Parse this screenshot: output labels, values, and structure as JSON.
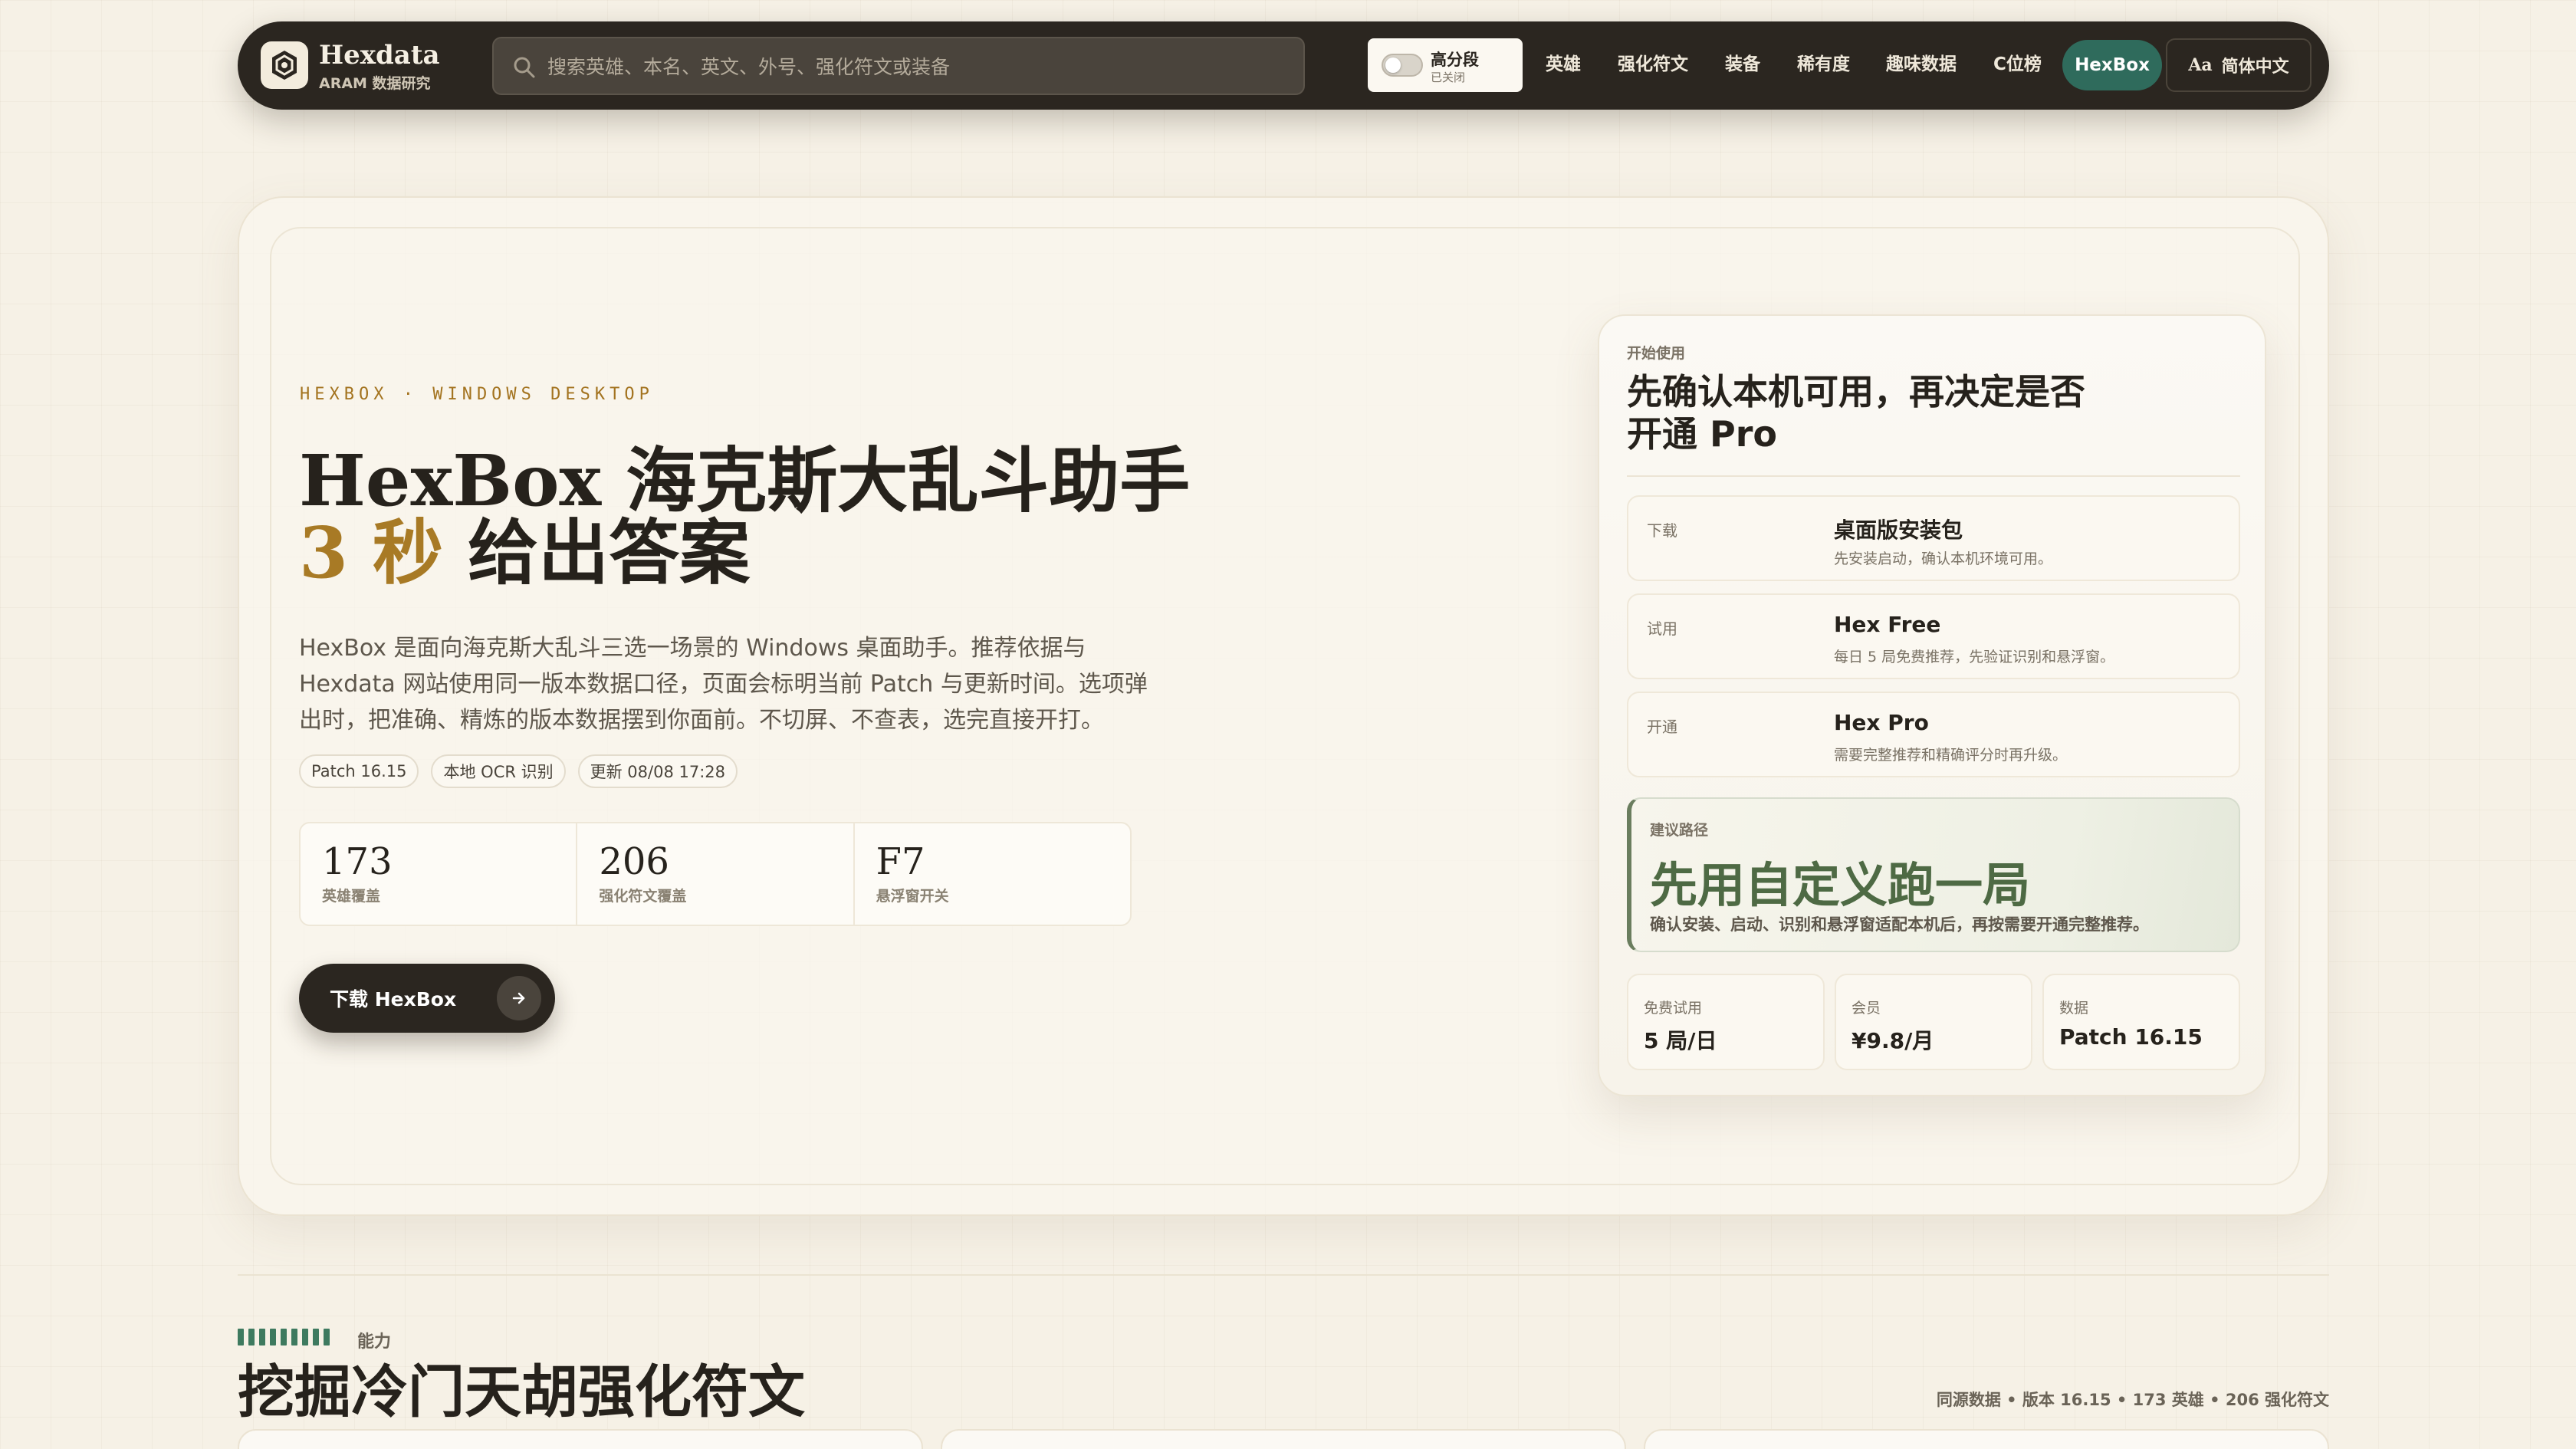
{
  "brand": {
    "name": "Hexdata",
    "subtitle": "ARAM 数据研究",
    "logo_icon": "hex-logo-icon"
  },
  "search": {
    "placeholder": "搜索英雄、本名、英文、外号、强化符文或装备"
  },
  "toggle": {
    "label": "高分段",
    "state": "已关闭",
    "on": false
  },
  "nav": {
    "links": [
      "英雄",
      "强化符文",
      "装备",
      "稀有度",
      "趣味数据",
      "C位榜"
    ],
    "active": "HexBox",
    "lang_icon": "Aa",
    "lang_label": "简体中文"
  },
  "hero": {
    "eyebrow": "HEXBOX · WINDOWS DESKTOP",
    "title_line1": "HexBox 海克斯大乱斗助手",
    "title_accent": "3 秒",
    "title_line2_rest": " 给出答案",
    "lead": "HexBox 是面向海克斯大乱斗三选一场景的 Windows 桌面助手。推荐依据与 Hexdata 网站使用同一版本数据口径，页面会标明当前 Patch 与更新时间。选项弹出时，把准确、精炼的版本数据摆到你面前。不切屏、不查表，选完直接开打。",
    "chips": [
      "Patch 16.15",
      "本地 OCR 识别",
      "更新 08/08 17:28"
    ],
    "stats": [
      {
        "value": "173",
        "label": "英雄覆盖"
      },
      {
        "value": "206",
        "label": "强化符文覆盖"
      },
      {
        "value": "F7",
        "label": "悬浮窗开关"
      }
    ],
    "cta_label": "下载 HexBox",
    "accent_color": "#a87a25"
  },
  "card": {
    "kicker": "开始使用",
    "title": "先确认本机可用，再决定是否开通 Pro",
    "steps": [
      {
        "key": "下载",
        "title": "桌面版安装包",
        "desc": "先安装启动，确认本机环境可用。"
      },
      {
        "key": "试用",
        "title": "Hex Free",
        "desc": "每日 5 局免费推荐，先验证识别和悬浮窗。"
      },
      {
        "key": "开通",
        "title": "Hex Pro",
        "desc": "需要完整推荐和精确评分时再升级。"
      }
    ],
    "path": {
      "kicker": "建议路径",
      "title": "先用自定义跑一局",
      "desc": "确认安装、启动、识别和悬浮窗适配本机后，再按需要开通完整推荐。"
    },
    "mini": [
      {
        "key": "免费试用",
        "value": "5 局/日"
      },
      {
        "key": "会员",
        "value": "¥9.8/月"
      },
      {
        "key": "数据",
        "value": "Patch 16.15"
      }
    ]
  },
  "section": {
    "kicker": "能力",
    "title": "挖掘冷门天胡强化符文",
    "meta": "同源数据 • 版本 16.15 • 173 英雄 • 206 强化符文"
  },
  "colors": {
    "nav_bg": "#2b2620",
    "active_pill": "#2f6b5c",
    "path_green": "#4e6a44",
    "bar_green": "#3e7a5f"
  }
}
